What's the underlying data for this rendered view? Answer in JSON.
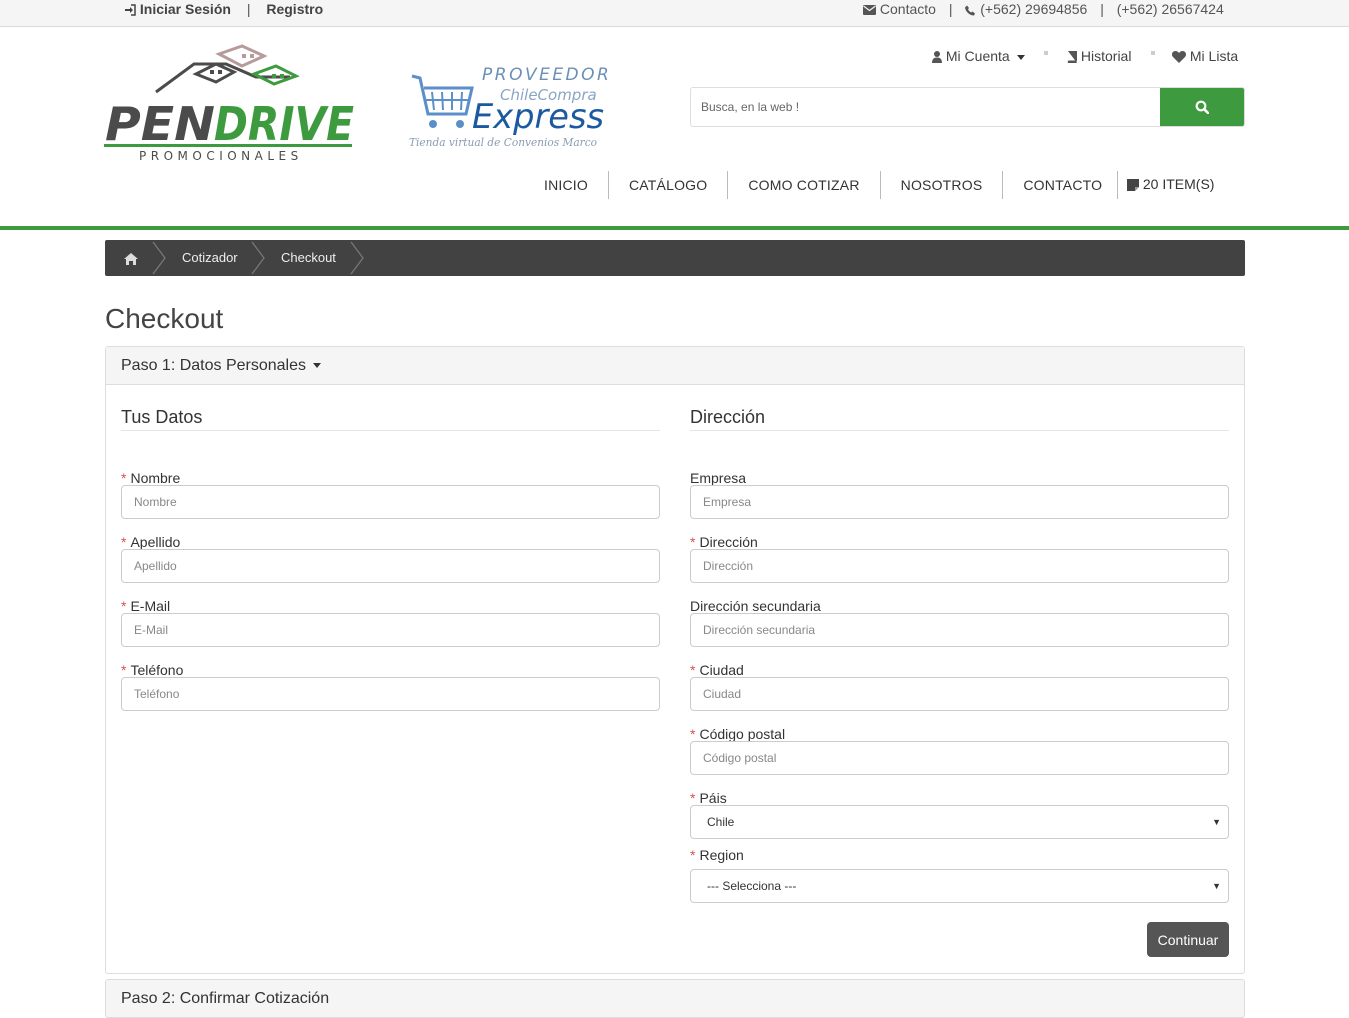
{
  "topbar": {
    "login": "Iniciar Sesión",
    "separator": "|",
    "register": "Registro",
    "contact": "Contacto",
    "phone1": "(+562) 29694856",
    "phone2": "(+562) 26567424"
  },
  "logo": {
    "brand": "PENDRIVE",
    "subtitle": "PROMOCIONALES",
    "colors": {
      "gray": "#4b4b4b",
      "green": "#3e9a3e"
    }
  },
  "partner_logo": {
    "line1": "PROVEEDOR",
    "line2": "ChileCompra",
    "line3": "Express",
    "tagline": "Tienda virtual de Convenios Marco"
  },
  "account_links": {
    "my_account": "Mi Cuenta",
    "history": "Historial",
    "wishlist": "Mi Lista"
  },
  "search": {
    "placeholder": "Busca, en la web !",
    "button_icon": "search-icon"
  },
  "nav": {
    "items": [
      "INICIO",
      "CATÁLOGO",
      "COMO COTIZAR",
      "NOSOTROS",
      "CONTACTO"
    ],
    "cart": "20 ITEM(S)"
  },
  "breadcrumb": {
    "home_icon": "home-icon",
    "items": [
      "Cotizador",
      "Checkout"
    ]
  },
  "page": {
    "title": "Checkout"
  },
  "step1": {
    "title": "Paso 1: Datos Personales",
    "personal": {
      "legend": "Tus Datos",
      "fields": [
        {
          "label": "Nombre",
          "placeholder": "Nombre",
          "required": true
        },
        {
          "label": "Apellido",
          "placeholder": "Apellido",
          "required": true
        },
        {
          "label": "E-Mail",
          "placeholder": "E-Mail",
          "required": true
        },
        {
          "label": "Teléfono",
          "placeholder": "Teléfono",
          "required": true
        }
      ]
    },
    "address": {
      "legend": "Dirección",
      "fields": [
        {
          "label": "Empresa",
          "placeholder": "Empresa",
          "required": false
        },
        {
          "label": "Dirección",
          "placeholder": "Dirección",
          "required": true
        },
        {
          "label": "Dirección secundaria",
          "placeholder": "Dirección secundaria",
          "required": false
        },
        {
          "label": "Ciudad",
          "placeholder": "Ciudad",
          "required": true
        },
        {
          "label": "Código postal",
          "placeholder": "Código postal",
          "required": true
        }
      ],
      "country": {
        "label": "Páis",
        "value": "Chile",
        "required": true
      },
      "region": {
        "label": "Region",
        "value": "--- Selecciona ---",
        "required": true
      }
    },
    "required_mark": "*",
    "continue_label": "Continuar"
  },
  "step2": {
    "title": "Paso 2: Confirmar Cotización"
  },
  "colors": {
    "accent": "#3e9a3e",
    "breadcrumb_bg": "#424242",
    "required": "#d9534f",
    "button": "#555555"
  }
}
